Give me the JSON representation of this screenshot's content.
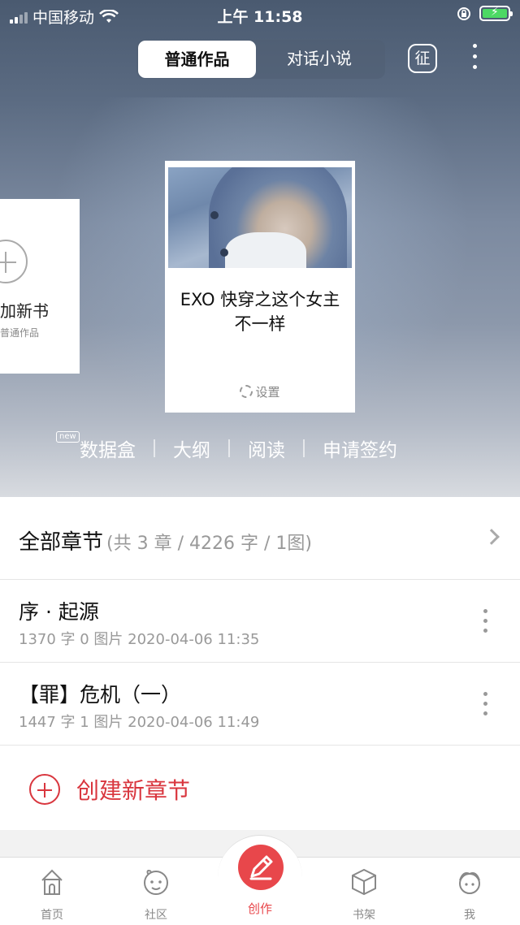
{
  "status_bar": {
    "carrier": "中国移动",
    "time": "上午 11:58"
  },
  "header": {
    "tabs": [
      {
        "label": "普通作品",
        "active": true
      },
      {
        "label": "对话小说",
        "active": false
      }
    ],
    "badge_label": "征"
  },
  "add_card": {
    "title": "加新书",
    "subtitle": "普通作品"
  },
  "book": {
    "title": "EXO 快穿之这个女主不一样",
    "setting_label": "设置"
  },
  "actions": {
    "new_badge": "new",
    "items": [
      "数据盒",
      "大纲",
      "阅读",
      "申请签约"
    ]
  },
  "chapters_header": {
    "title": "全部章节",
    "summary": "(共 3 章 / 4226 字 / 1图)"
  },
  "chapters": [
    {
      "name": "序 · 起源",
      "info": "1370 字 0 图片 2020-04-06 11:35"
    },
    {
      "name": "【罪】危机（一）",
      "info": "1447 字 1 图片 2020-04-06 11:49"
    }
  ],
  "create_chapter_label": "创建新章节",
  "tabbar": [
    {
      "label": "首页",
      "icon": "home-icon"
    },
    {
      "label": "社区",
      "icon": "community-icon"
    },
    {
      "label": "创作",
      "icon": "pen-icon",
      "active": true
    },
    {
      "label": "书架",
      "icon": "bookshelf-icon"
    },
    {
      "label": "我",
      "icon": "profile-icon"
    }
  ],
  "colors": {
    "accent": "#e8474b",
    "battery": "#4cd964"
  }
}
